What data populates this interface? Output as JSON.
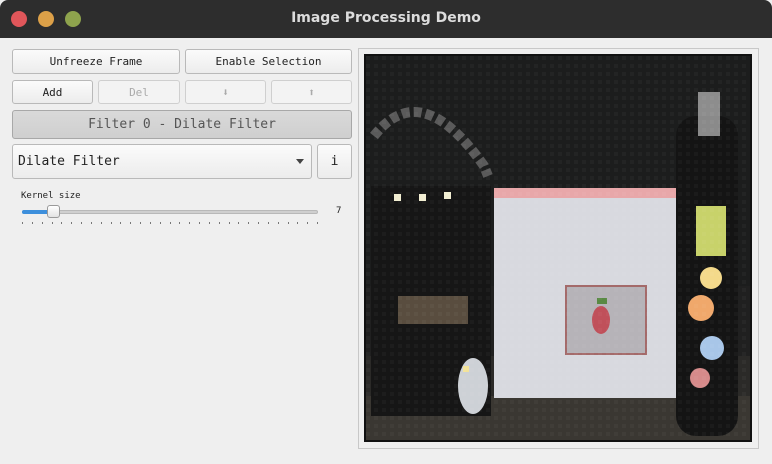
{
  "window": {
    "title": "Image Processing Demo"
  },
  "toolbar": {
    "unfreeze_label": "Unfreeze Frame",
    "enable_selection_label": "Enable Selection",
    "add_label": "Add",
    "del_label": "Del",
    "move_down_label": "⬇",
    "move_up_label": "⬆",
    "filter_title_label": "Filter 0 - Dilate Filter"
  },
  "filter_select": {
    "selected": "Dilate Filter",
    "info_label": "i"
  },
  "kernel": {
    "label": "Kernel size",
    "value": "7",
    "fraction": 0.105
  },
  "frame": {
    "description_icon": "camera-frame-icon"
  }
}
